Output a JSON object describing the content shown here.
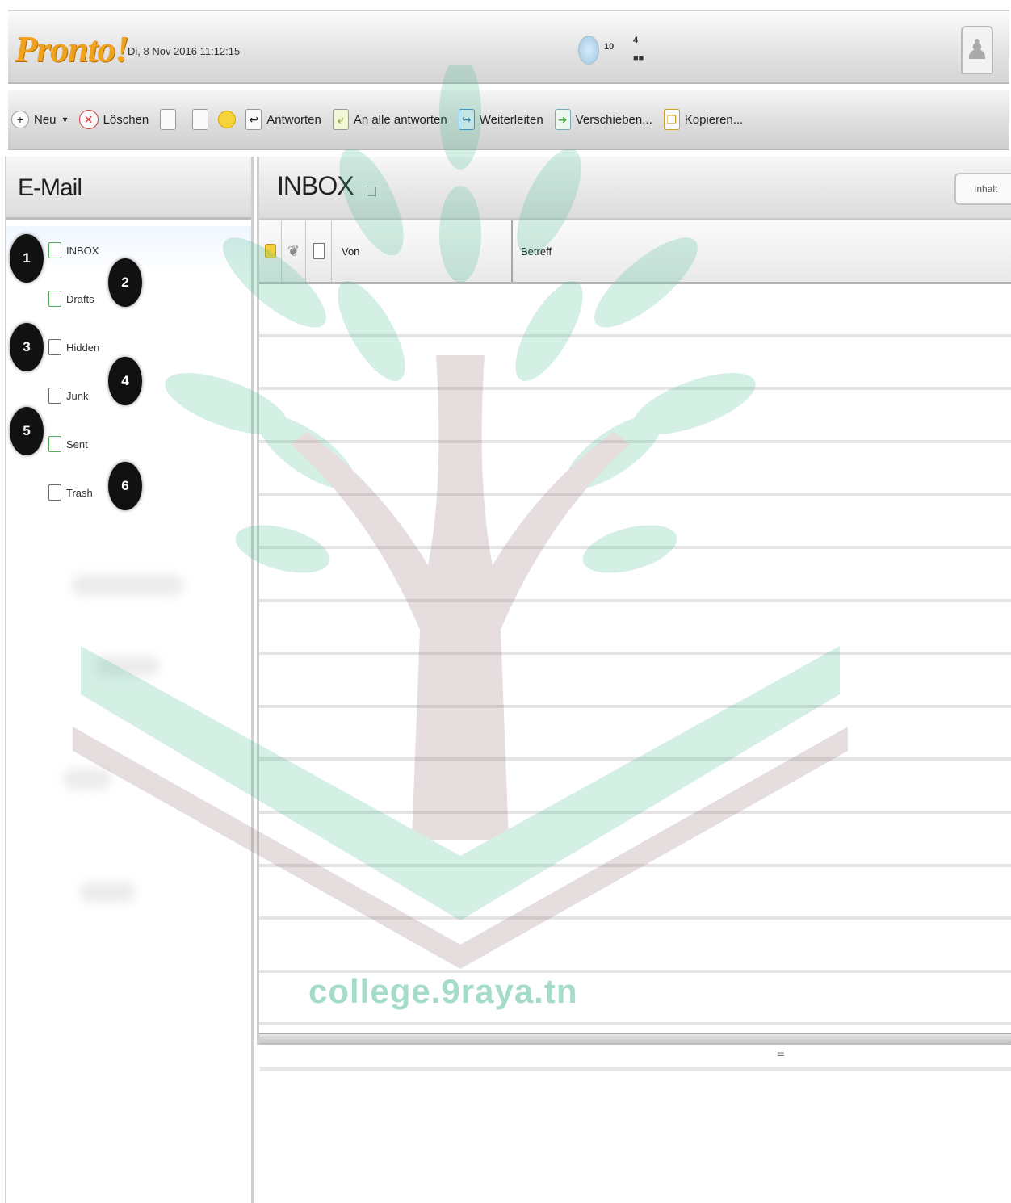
{
  "header": {
    "logo_text": "Pronto!",
    "datetime": "Di, 8 Nov 2016 11:12:15",
    "widget": {
      "line1": "10",
      "line2": "4",
      "line3": "■■"
    }
  },
  "toolbar": {
    "items": [
      {
        "id": "new",
        "label": "Neu",
        "icon": "new-icon",
        "glyph": "+"
      },
      {
        "id": "delete",
        "label": "Löschen",
        "icon": "delete-icon",
        "glyph": "✕"
      },
      {
        "id": "reply",
        "label": "Antworten",
        "icon": "reply-icon",
        "glyph": "↩"
      },
      {
        "id": "reply-all",
        "label": "An alle antworten",
        "icon": "reply-all-icon",
        "glyph": "⤶"
      },
      {
        "id": "forward",
        "label": "Weiterleiten",
        "icon": "forward-icon",
        "glyph": "↪"
      },
      {
        "id": "move",
        "label": "Verschieben...",
        "icon": "move-icon",
        "glyph": "➜"
      },
      {
        "id": "tag",
        "label": "Kopieren...",
        "icon": "copy-icon",
        "glyph": "❐"
      }
    ],
    "new_dropdown": "▾"
  },
  "left_panel": {
    "title": "E-Mail",
    "folders": [
      {
        "label": "INBOX",
        "marker": "1"
      },
      {
        "label": "Drafts",
        "marker": "2"
      },
      {
        "label": "Hidden",
        "marker": "3"
      },
      {
        "label": "Junk",
        "marker": "4"
      },
      {
        "label": "Sent",
        "marker": "5"
      },
      {
        "label": "Trash",
        "marker": "6"
      }
    ]
  },
  "main": {
    "title": "INBOX",
    "search_label": "Inhalt",
    "columns": {
      "from": "Von",
      "subject": "Betreff"
    }
  },
  "watermark": {
    "text": "college.9raya.tn"
  },
  "colors": {
    "logo": "#f0a21e",
    "watermark": "#a5dcc7"
  }
}
